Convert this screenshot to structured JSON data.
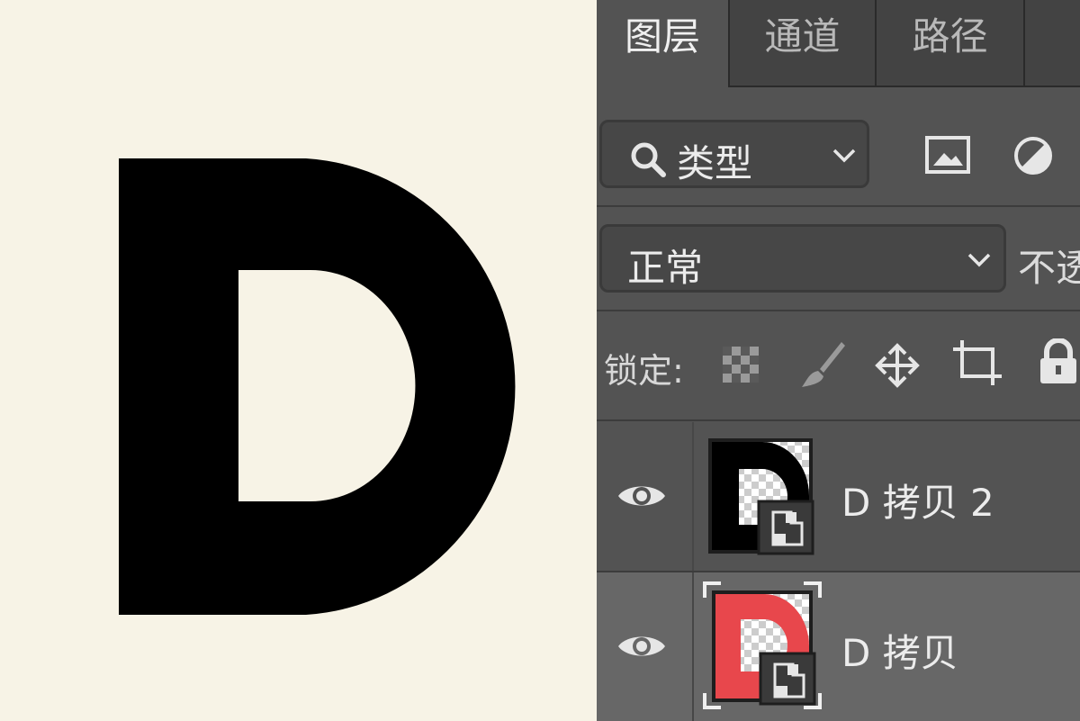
{
  "canvas": {
    "letter": "D",
    "letter_color": "#000000",
    "background": "#f7f3e6"
  },
  "panel": {
    "tabs": [
      {
        "label": "图层",
        "active": true
      },
      {
        "label": "通道",
        "active": false
      },
      {
        "label": "路径",
        "active": false
      }
    ],
    "filter": {
      "label": "类型"
    },
    "blend_mode": {
      "value": "正常"
    },
    "opacity_label": "不透",
    "lock": {
      "label": "锁定:"
    },
    "layers": [
      {
        "name": "D 拷贝 2",
        "visible": true,
        "selected": false,
        "thumb_color": "#000000"
      },
      {
        "name": "D 拷贝",
        "visible": true,
        "selected": true,
        "thumb_color": "#e8474c"
      }
    ]
  },
  "icons": [
    "search-icon",
    "chevron-down-icon",
    "image-filter-icon",
    "adjustment-filter-icon",
    "lock-transparent-icon",
    "brush-icon",
    "move-icon",
    "artboard-icon",
    "lock-icon",
    "eye-icon",
    "smart-object-badge-icon"
  ]
}
